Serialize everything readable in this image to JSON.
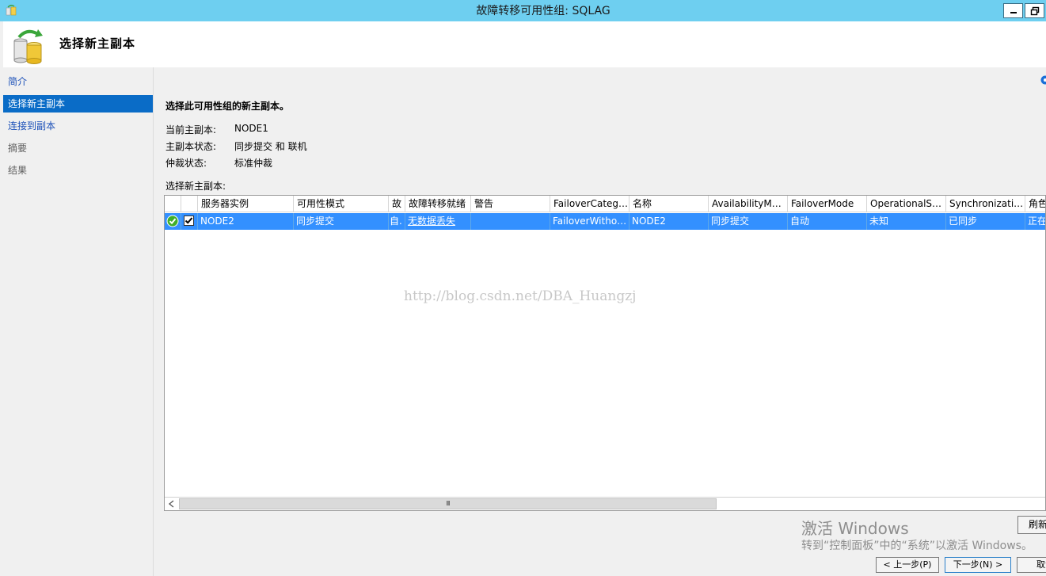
{
  "window": {
    "title": "故障转移可用性组: SQLAG"
  },
  "header": {
    "title": "选择新主副本"
  },
  "nav": {
    "items": [
      {
        "label": "简介"
      },
      {
        "label": "选择新主副本"
      },
      {
        "label": "连接到副本"
      },
      {
        "label": "摘要"
      },
      {
        "label": "结果"
      }
    ]
  },
  "main": {
    "heading": "选择此可用性组的新主副本。",
    "info": [
      {
        "label": "当前主副本:",
        "value": "NODE1"
      },
      {
        "label": "主副本状态:",
        "value": "同步提交 和 联机"
      },
      {
        "label": "仲裁状态:",
        "value": "标准仲裁"
      }
    ],
    "grid_label": "选择新主副本:"
  },
  "grid": {
    "columns": [
      "服务器实例",
      "可用性模式",
      "故",
      "故障转移就绪",
      "警告",
      "FailoverCateg…",
      "名称",
      "AvailabilityM…",
      "FailoverMode",
      "OperationalS…",
      "Synchronizati…",
      "角色"
    ],
    "row": {
      "checked": true,
      "status_icon": "check-circle-icon",
      "cells": [
        "NODE2",
        "同步提交",
        "自.",
        "无数据丢失",
        "",
        "FailoverWitho…",
        "NODE2",
        "同步提交",
        "自动",
        "未知",
        "已同步",
        "正在"
      ]
    },
    "scroll_glyph": "III"
  },
  "watermark": "http://blog.csdn.net/DBA_Huangzj",
  "buttons": {
    "refresh": "刷新",
    "prev": "< 上一步(P)",
    "next": "下一步(N) >",
    "cancel": "取消"
  },
  "activation": {
    "title": "激活 Windows",
    "subtitle": "转到“控制面板”中的“系统”以激活 Windows。"
  },
  "colors": {
    "titlebar": "#6ecff0",
    "selection": "#3390ff",
    "nav_selected": "#0a6cc7",
    "link": "#1a4fb8"
  }
}
